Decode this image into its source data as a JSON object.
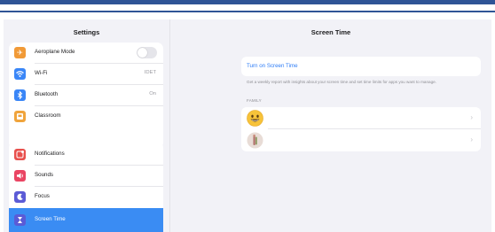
{
  "sidebar": {
    "title": "Settings",
    "group1": [
      {
        "label": "Aeroplane Mode",
        "icon": "aeroplane-icon",
        "color": "#f19a37",
        "toggle": false
      },
      {
        "label": "Wi-Fi",
        "icon": "wifi-icon",
        "color": "#3a86f7",
        "value": "IDET"
      },
      {
        "label": "Bluetooth",
        "icon": "bluetooth-icon",
        "color": "#3a86f7",
        "value": "On"
      },
      {
        "label": "Classroom",
        "icon": "classroom-icon",
        "color": "#f0a43c"
      }
    ],
    "group2": [
      {
        "label": "Notifications",
        "icon": "notifications-icon",
        "color": "#e8504d"
      },
      {
        "label": "Sounds",
        "icon": "sounds-icon",
        "color": "#ea4563"
      },
      {
        "label": "Focus",
        "icon": "focus-icon",
        "color": "#5b5bd6"
      },
      {
        "label": "Screen Time",
        "icon": "screen-time-icon",
        "color": "#5b5bd6",
        "selected": true
      }
    ]
  },
  "main": {
    "title": "Screen Time",
    "turn_on_label": "Turn on Screen Time",
    "description": "Get a weekly report with insights about your screen time and set time limits for apps you want to manage.",
    "family_header": "FAMILY",
    "members": [
      {
        "avatar": "smiley-avatar"
      },
      {
        "avatar": "photo-avatar"
      }
    ]
  },
  "colors": {
    "accent": "#3a8cf3",
    "link": "#2d7cf6",
    "background": "#f2f2f7"
  }
}
